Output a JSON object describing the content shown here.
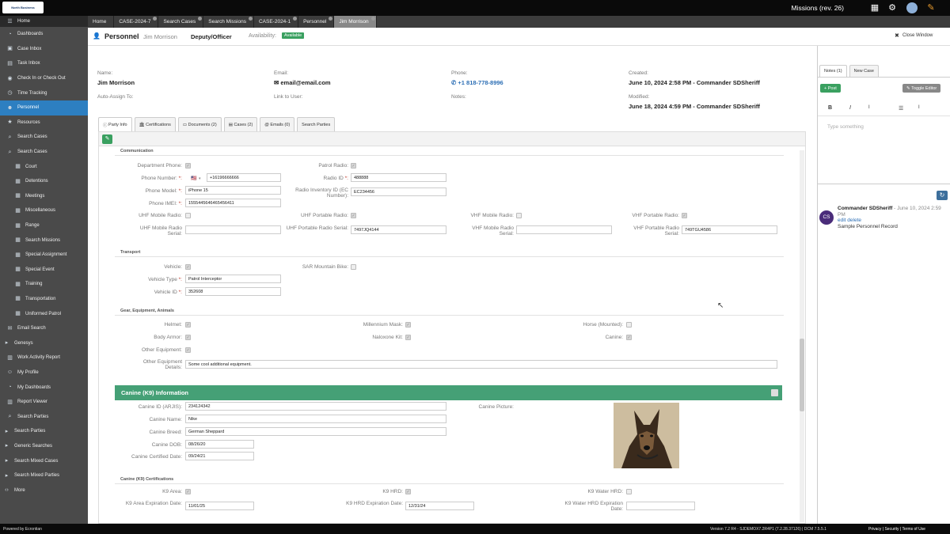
{
  "app": {
    "title": "Missions (rev. 26)",
    "logo_text": "North Business"
  },
  "window_tabs": [
    "Home",
    "CASE-2024-7",
    "Search Cases",
    "Search Missions",
    "CASE-2024-1",
    "Personnel",
    "Jim Morrison"
  ],
  "sidebar": {
    "home": "Home",
    "items": [
      {
        "label": "Dashboards",
        "icon": "dashboard-icon"
      },
      {
        "label": "Case Inbox",
        "icon": "inbox-icon"
      },
      {
        "label": "Task Inbox",
        "icon": "task-icon"
      },
      {
        "label": "Check In or Check Out",
        "icon": "check-icon"
      },
      {
        "label": "Time Tracking",
        "icon": "clock-icon"
      },
      {
        "label": "Personnel",
        "icon": "person-icon",
        "active": true
      },
      {
        "label": "Resources",
        "icon": "star-icon"
      },
      {
        "label": "Search Cases",
        "icon": "search-icon"
      },
      {
        "label": "Search Cases",
        "icon": "search-icon"
      },
      {
        "label": "Court",
        "icon": "grid-icon",
        "indent": true
      },
      {
        "label": "Detentions",
        "icon": "grid-icon",
        "indent": true
      },
      {
        "label": "Meetings",
        "icon": "grid-icon",
        "indent": true
      },
      {
        "label": "Miscellaneous",
        "icon": "grid-icon",
        "indent": true
      },
      {
        "label": "Range",
        "icon": "grid-icon",
        "indent": true
      },
      {
        "label": "Search Missions",
        "icon": "grid-icon",
        "indent": true
      },
      {
        "label": "Special Assignment",
        "icon": "grid-icon",
        "indent": true
      },
      {
        "label": "Special Event",
        "icon": "grid-icon",
        "indent": true
      },
      {
        "label": "Training",
        "icon": "grid-icon",
        "indent": true
      },
      {
        "label": "Transportation",
        "icon": "grid-icon",
        "indent": true
      },
      {
        "label": "Uniformed Patrol",
        "icon": "grid-icon",
        "indent": true
      },
      {
        "label": "Email Search",
        "icon": "email-icon"
      },
      {
        "label": "Genesys",
        "icon": "folder-icon",
        "caret": true
      },
      {
        "label": "Work Activity Report",
        "icon": "report-icon"
      },
      {
        "label": "My Profile",
        "icon": "profile-icon"
      },
      {
        "label": "My Dashboards",
        "icon": "dashboard-icon"
      },
      {
        "label": "Report Viewer",
        "icon": "report-icon"
      },
      {
        "label": "Search Parties",
        "icon": "search-icon"
      },
      {
        "label": "Search Parties",
        "icon": "folder-icon",
        "caret": true
      },
      {
        "label": "Generic Searches",
        "icon": "folder-icon",
        "caret": true
      },
      {
        "label": "Search Mixed Cases",
        "icon": "folder-icon",
        "caret": true
      },
      {
        "label": "Search Mixed Parties",
        "icon": "folder-icon",
        "caret": true
      },
      {
        "label": "More",
        "icon": "more-icon",
        "caret": true
      }
    ]
  },
  "header": {
    "module": "Personnel",
    "name": "Jim Morrison",
    "role": "Deputy/Officer",
    "availability_label": "Availability:",
    "availability": "Available",
    "close": "Close Window"
  },
  "summary": {
    "name_label": "Name:",
    "name": "Jim Morrison",
    "email_label": "Email:",
    "email": "email@email.com",
    "phone_label": "Phone:",
    "phone": "+1 818-778-8996",
    "created_label": "Created:",
    "created": "June 10, 2024 2:58 PM - Commander SDSheriff",
    "auto_assign_label": "Auto-Assign To:",
    "link_user_label": "Link to User:",
    "notes_label": "Notes:",
    "modified_label": "Modified:",
    "modified": "June 18, 2024 4:59 PM - Commander SDSheriff"
  },
  "subtabs": [
    "Party Info",
    "Certifications",
    "Documents (2)",
    "Cases (2)",
    "Emails (0)",
    "Search Parties"
  ],
  "communication": {
    "title": "Communication",
    "dept_phone": "Department Phone:",
    "phone_number": "Phone Number:",
    "phone_number_val": "+16196666666",
    "phone_model": "Phone Model:",
    "phone_model_val": "iPhone 15",
    "phone_imei": "Phone IMEI:",
    "phone_imei_val": "1555445646465456411",
    "patrol_radio": "Patrol Radio:",
    "radio_id": "Radio ID",
    "radio_id_val": "488888",
    "radio_inv": "Radio Inventory ID (EC Number):",
    "radio_inv_val": "EC234456",
    "uhf_mobile": "UHF Mobile Radio:",
    "uhf_portable": "UHF Portable Radio:",
    "vhf_mobile": "VHF Mobile Radio:",
    "vhf_portable": "VHF Portable Radio:",
    "uhf_mobile_serial": "UHF Mobile Radio Serial:",
    "uhf_portable_serial": "UHF Portable Radio Serial:",
    "uhf_portable_serial_val": "7497JQ4144",
    "vhf_mobile_serial": "VHF Mobile Radio Serial:",
    "vhf_portable_serial": "VHF Portable Radio Serial:",
    "vhf_portable_serial_val": "749TGU4586"
  },
  "transport": {
    "title": "Transport",
    "vehicle": "Vehicle:",
    "sar_bike": "SAR Mountain Bike:",
    "vehicle_type": "Vehicle Type",
    "vehicle_type_val": "Patrol Interceptor",
    "vehicle_id": "Vehicle ID",
    "vehicle_id_val": "352608"
  },
  "gear": {
    "title": "Gear, Equipment, Animals",
    "helmet": "Helmet:",
    "millennium": "Millennium Mask:",
    "horse": "Horse (Mounted):",
    "body_armor": "Body Armor:",
    "naloxone": "Naloxone Kit:",
    "canine": "Canine:",
    "other_eq": "Other Equipment:",
    "other_details": "Other Equipment Details:",
    "other_details_val": "Some cool additional equipment."
  },
  "k9": {
    "title": "Canine (K9) Information",
    "id": "Canine ID (ARJIS):",
    "id_val": "234124342",
    "name": "Canine Name:",
    "name_val": "Nike",
    "breed": "Canine Breed:",
    "breed_val": "German Sheppard",
    "dob": "Canine DOB:",
    "dob_val": "08/26/20",
    "certified": "Canine Certified Date:",
    "certified_val": "09/24/21",
    "picture": "Canine Picture:"
  },
  "k9cert": {
    "title": "Canine (K9) Certifications",
    "area": "K9 Area:",
    "hrd": "K9 HRD:",
    "water": "K9 Water HRD:",
    "area_exp": "K9 Area Expiration Date:",
    "area_exp_val": "11/01/25",
    "hrd_exp": "K9 HRD Expiration Date:",
    "hrd_exp_val": "12/31/24",
    "water_exp": "K9 Water HRD Expiration Date:"
  },
  "notes_panel": {
    "tab_notes": "Notes (1)",
    "tab_new_case": "New Case",
    "post": "Post",
    "toggle": "Toggle Editor",
    "placeholder": "Type something",
    "author": "Commander SDSheriff",
    "date": "- June 10, 2024 2:59 PM",
    "actions": "edit delete",
    "text": "Sample Personnel Record",
    "initials": "CS"
  },
  "footer": {
    "left": "Powered by Ecrontian",
    "version": "Version 7.2 R4 - SJDEMOX7.2R4P1 (7.2.28.37126) | DCM 7.5.5.1",
    "links": "Privacy | Security | Terms of Use"
  },
  "colors": {
    "accent": "#2d7fc1",
    "green": "#45a076",
    "sidebar": "#4a4a4a"
  }
}
